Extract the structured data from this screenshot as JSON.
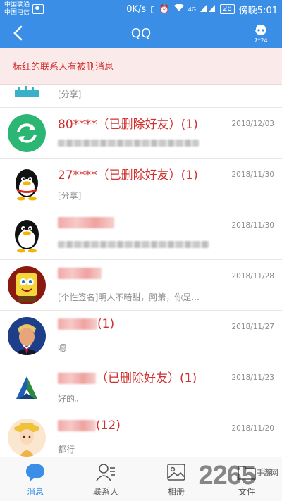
{
  "status_bar": {
    "carrier_1": "中国联通",
    "carrier_2": "中国电信",
    "speed": "0K/s",
    "signal_label": "4G",
    "battery": "28",
    "time": "傍晚5:01"
  },
  "nav": {
    "title": "QQ",
    "service_label": "7*24"
  },
  "notice": {
    "text": "标红的联系人有被删消息"
  },
  "contacts": [
    {
      "name": "",
      "name_suffix": "",
      "red": false,
      "time": "",
      "message": "[分享]",
      "avatar": "partial-icon"
    },
    {
      "name": "80****（已删除好友）(1)",
      "name_suffix": "",
      "red": true,
      "time": "2018/12/03",
      "message": "",
      "avatar": "green-refresh"
    },
    {
      "name": "27****（已删除好友）(1)",
      "name_suffix": "",
      "red": true,
      "time": "2018/11/30",
      "message": "[分享]",
      "avatar": "qq-penguin"
    },
    {
      "name": "",
      "name_suffix": "",
      "red": true,
      "time": "2018/11/30",
      "message": "",
      "avatar": "qq-penguin-2"
    },
    {
      "name": "",
      "name_suffix": "",
      "red": true,
      "time": "2018/11/28",
      "message": "[个性签名]明人不暗甜，阿箫，你是...",
      "avatar": "cartoon-sponge"
    },
    {
      "name": "",
      "name_suffix": "(1)",
      "red": true,
      "time": "2018/11/27",
      "message": "嗯",
      "avatar": "person-photo"
    },
    {
      "name": "",
      "name_suffix": "（已删除好友）(1)",
      "red": true,
      "time": "2018/11/23",
      "message": "好的。",
      "avatar": "triangle-logo"
    },
    {
      "name": "",
      "name_suffix": "(12)",
      "red": true,
      "time": "2018/11/20",
      "message": "都行",
      "avatar": "cartoon-girl"
    }
  ],
  "tabs": [
    {
      "label": "消息",
      "icon": "chat-bubble-icon",
      "active": true
    },
    {
      "label": "联系人",
      "icon": "contacts-icon",
      "active": false
    },
    {
      "label": "相册",
      "icon": "album-icon",
      "active": false
    },
    {
      "label": "文件",
      "icon": "folder-icon",
      "active": false
    }
  ],
  "watermark": {
    "text": "2265",
    "sub": "手游网"
  },
  "colors": {
    "accent": "#3a8ee6",
    "deleted_red": "#d0302e",
    "notice_bg": "#fbeaea"
  }
}
